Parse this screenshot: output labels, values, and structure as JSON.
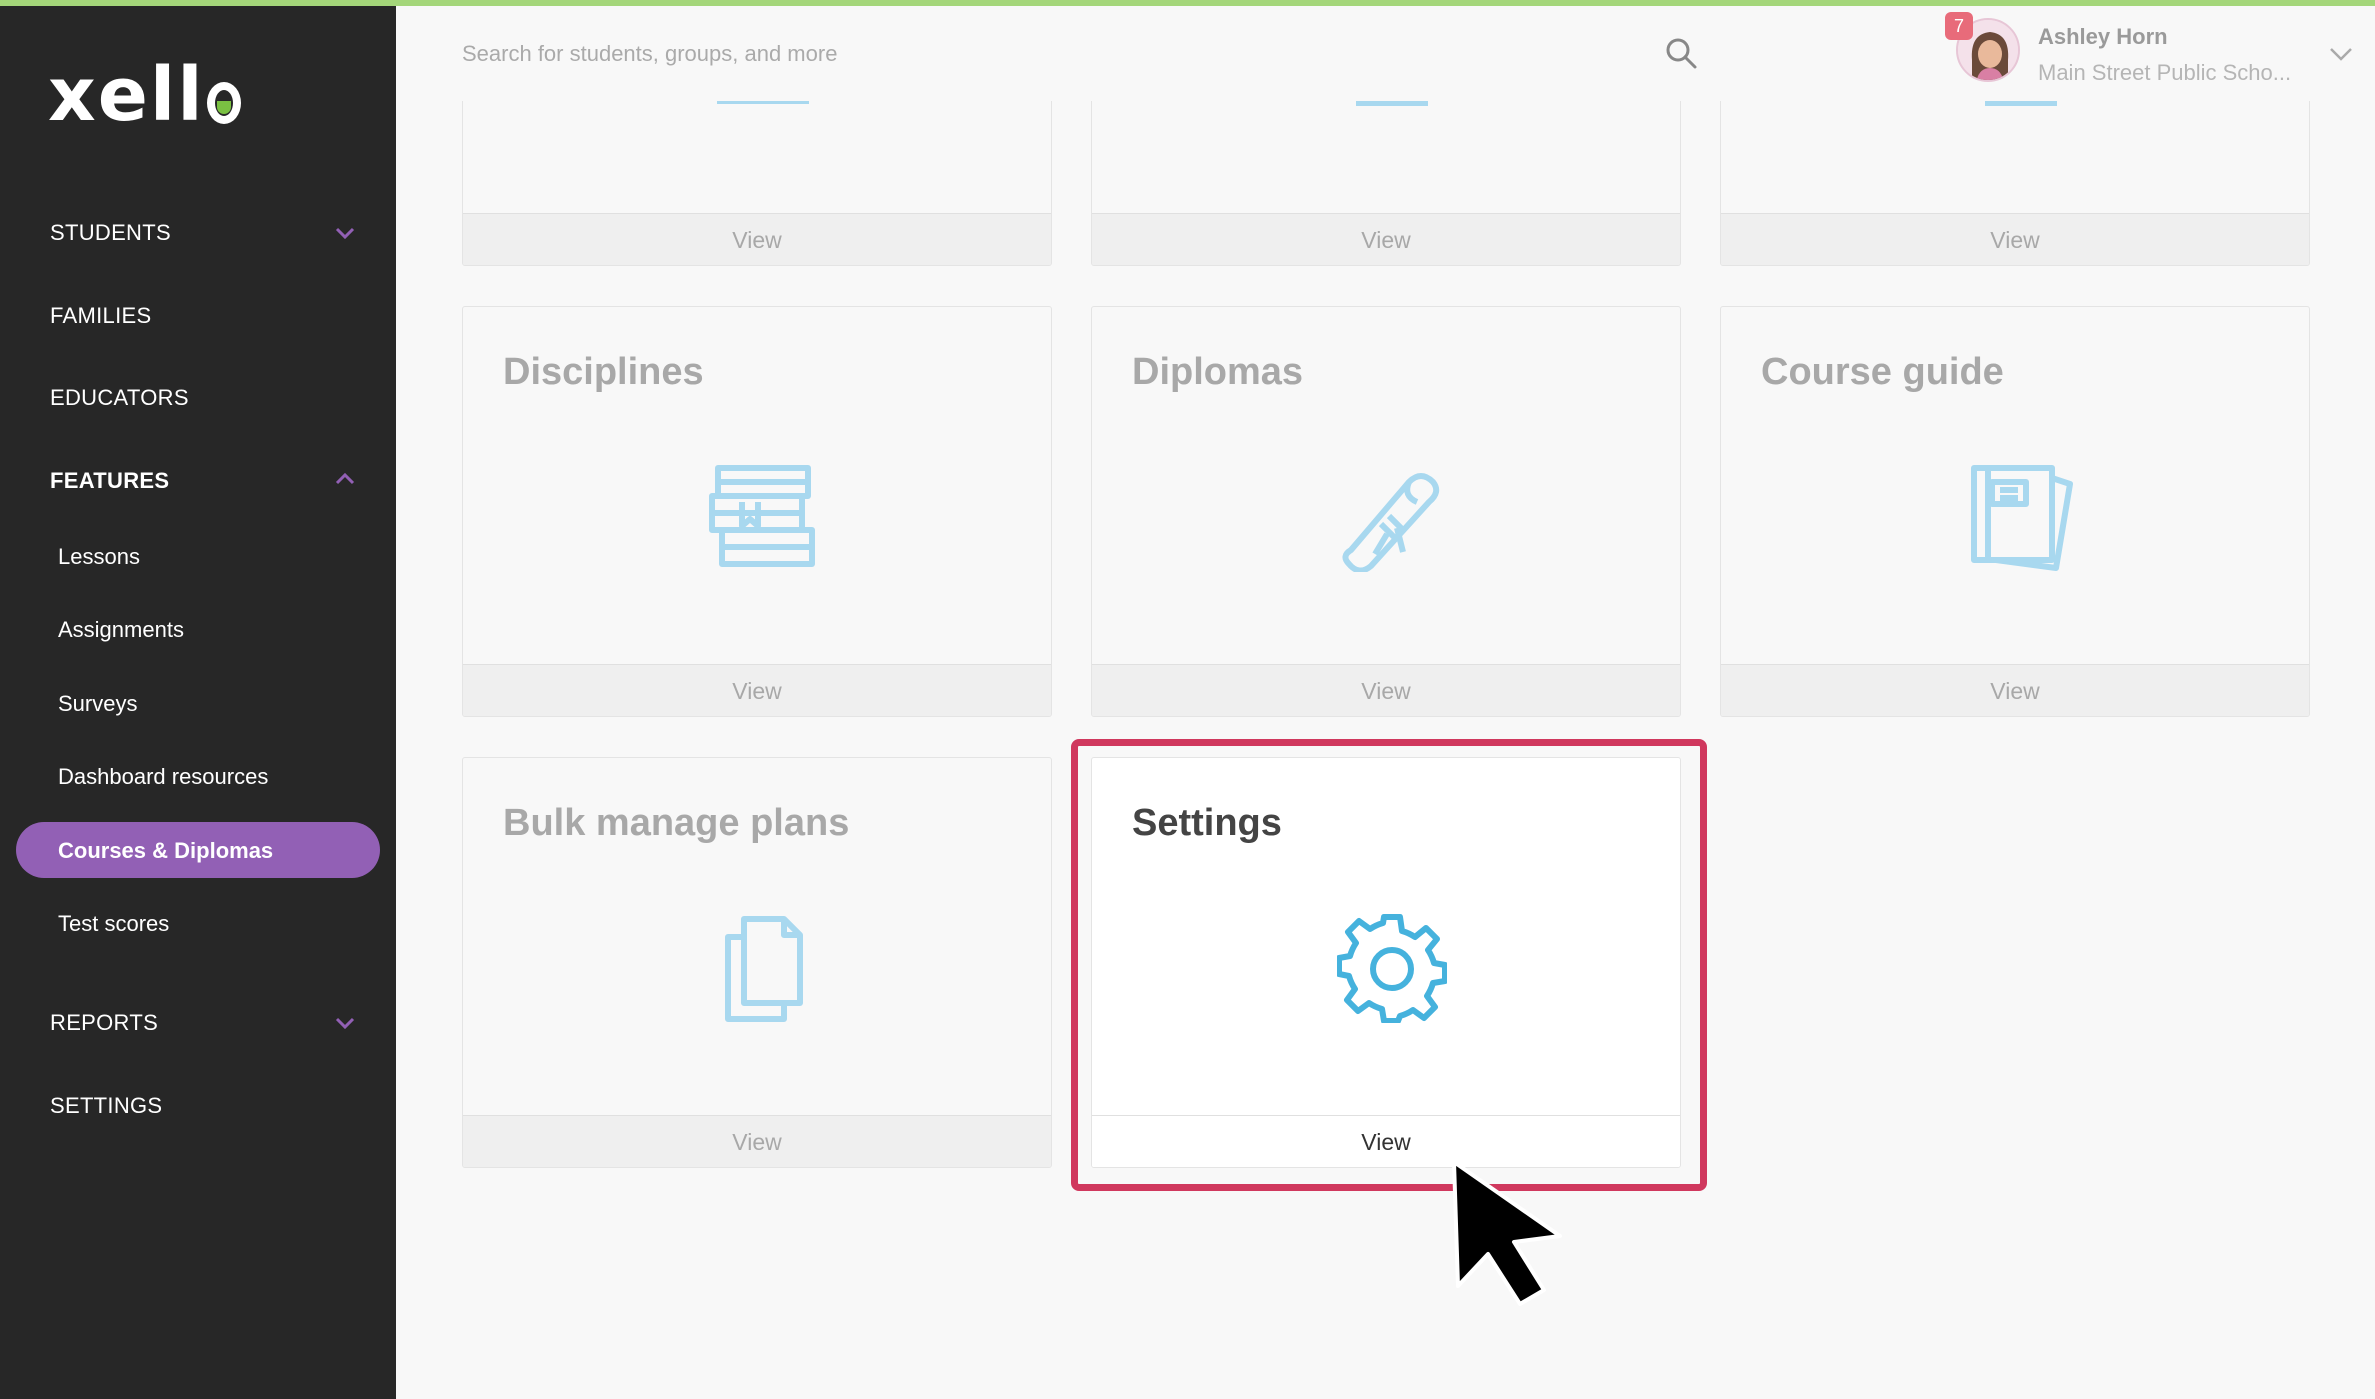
{
  "app": {
    "logo_text": "xell",
    "accent_color": "#9260b5",
    "icon_color": "#5bbde4"
  },
  "sidebar": {
    "sections": [
      {
        "label": "STUDENTS",
        "expanded": false
      },
      {
        "label": "FAMILIES"
      },
      {
        "label": "EDUCATORS"
      },
      {
        "label": "FEATURES",
        "expanded": true
      },
      {
        "label": "REPORTS",
        "expanded": false
      },
      {
        "label": "SETTINGS"
      }
    ],
    "features_items": [
      {
        "label": "Lessons"
      },
      {
        "label": "Assignments"
      },
      {
        "label": "Surveys"
      },
      {
        "label": "Dashboard resources"
      },
      {
        "label": "Courses & Diplomas",
        "active": true
      },
      {
        "label": "Test scores"
      }
    ]
  },
  "topbar": {
    "search_placeholder": "Search for students, groups, and more",
    "notification_count": "7",
    "user_name": "Ashley Horn",
    "user_school": "Main Street Public Scho..."
  },
  "cards": {
    "row1": [
      {
        "view_label": "View"
      },
      {
        "view_label": "View"
      },
      {
        "view_label": "View"
      }
    ],
    "row2": [
      {
        "title": "Disciplines",
        "icon": "books-icon",
        "view_label": "View"
      },
      {
        "title": "Diplomas",
        "icon": "diploma-icon",
        "view_label": "View"
      },
      {
        "title": "Course guide",
        "icon": "course-guide-icon",
        "view_label": "View"
      }
    ],
    "row3": [
      {
        "title": "Bulk manage plans",
        "icon": "documents-icon",
        "view_label": "View"
      },
      {
        "title": "Settings",
        "icon": "gear-icon",
        "view_label": "View",
        "highlighted": true
      }
    ]
  }
}
